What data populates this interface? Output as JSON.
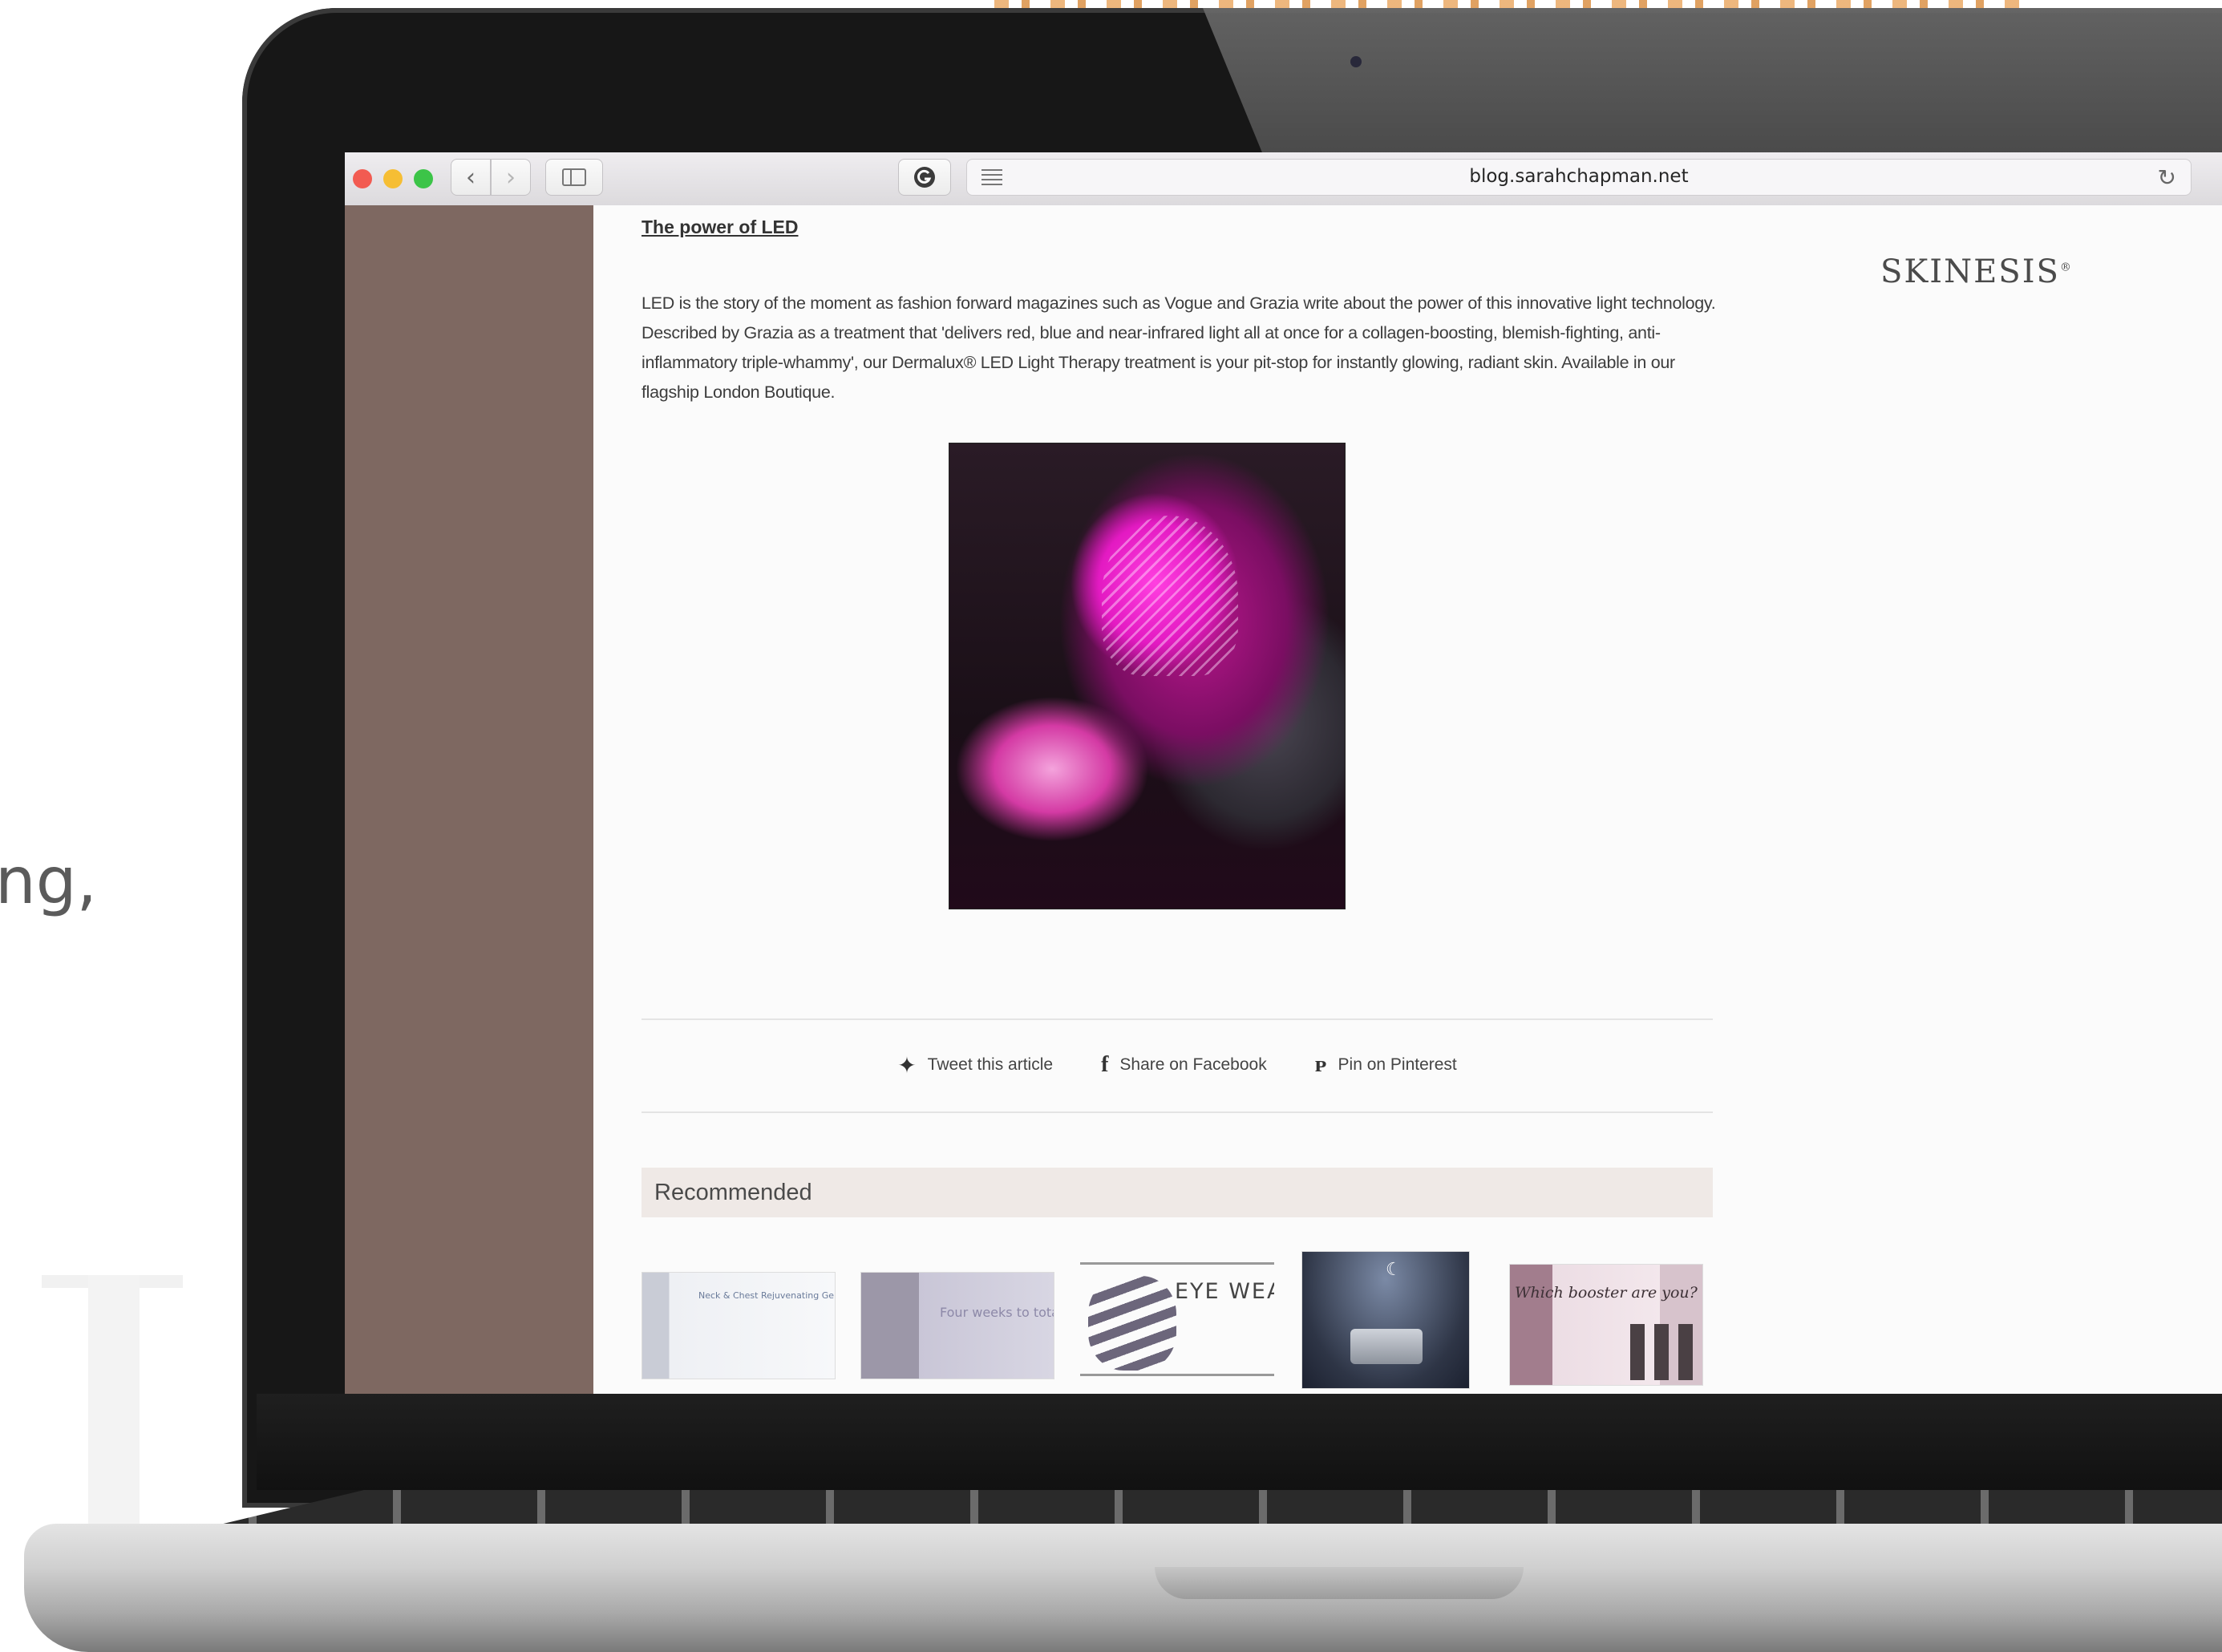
{
  "background": {
    "side_text": "ng,"
  },
  "browser": {
    "window_controls": [
      "close",
      "minimize",
      "zoom"
    ],
    "url": "blog.sarahchapman.net",
    "icons": {
      "back": "chevron-left-icon",
      "forward": "chevron-right-icon",
      "sidebar": "sidebar-icon",
      "extension": "grammarly-icon",
      "reader": "reader-icon",
      "reload": "reload-icon"
    }
  },
  "page": {
    "title": "The power of LED",
    "intro": "LED is the story of the moment as fashion forward magazines such as Vogue and Grazia write about the power of this innovative light technology. Described by Grazia as a treatment that 'delivers red, blue and near-infrared light all at once for a collagen-boosting, blemish-fighting, anti-inflammatory triple-whammy', our Dermalux® LED Light Therapy treatment is your pit-stop for instantly glowing, radiant skin. Available in our flagship London Boutique.",
    "brand": "SKINESIS",
    "brand_mark": "®",
    "share": {
      "twitter": "Tweet this article",
      "facebook": "Share on Facebook",
      "pinterest": "Pin on Pinterest"
    },
    "recommended": {
      "heading": "Recommended",
      "thumbnails": [
        {
          "caption": "Neck & Chest Rejuvenating Gel"
        },
        {
          "caption": "Four weeks to total skin transformation"
        },
        {
          "caption": "EYE WEA"
        },
        {
          "caption": ""
        },
        {
          "caption": "Which booster are you?"
        }
      ]
    }
  },
  "colors": {
    "left_panel": "#7e6861",
    "recommended_bg": "#efe9e6",
    "traffic_red": "#f25b51",
    "traffic_yellow": "#f6be34",
    "traffic_green": "#3cc448"
  }
}
